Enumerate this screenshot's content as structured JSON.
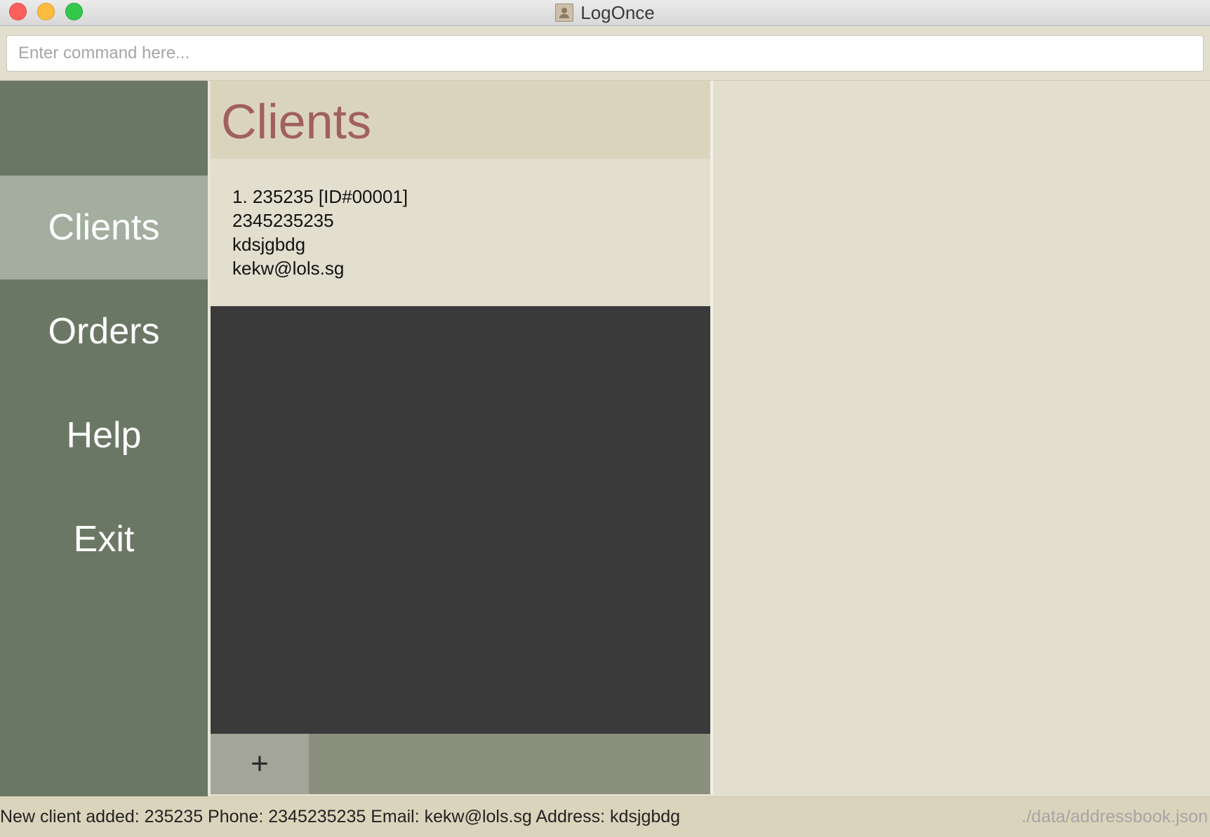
{
  "window": {
    "title": "LogOnce"
  },
  "command": {
    "placeholder": "Enter command here...",
    "value": ""
  },
  "sidebar": {
    "items": [
      {
        "label": "Clients",
        "active": true
      },
      {
        "label": "Orders",
        "active": false
      },
      {
        "label": "Help",
        "active": false
      },
      {
        "label": "Exit",
        "active": false
      }
    ]
  },
  "list": {
    "title": "Clients",
    "clients": [
      {
        "heading": "1.  235235 [ID#00001]",
        "phone": "2345235235",
        "address": "kdsjgbdg",
        "email": "kekw@lols.sg"
      }
    ],
    "add_label": "+"
  },
  "status": {
    "message": "New client added: 235235 Phone: 2345235235 Email: kekw@lols.sg Address: kdsjgbdg",
    "file_path": "./data/addressbook.json"
  },
  "colors": {
    "sidebar_bg": "#6b7765",
    "sidebar_active": "#a3ae9f",
    "title_accent": "#a0605f",
    "panel_bg": "#e2dfcf",
    "list_bg": "#3a3a3a"
  }
}
